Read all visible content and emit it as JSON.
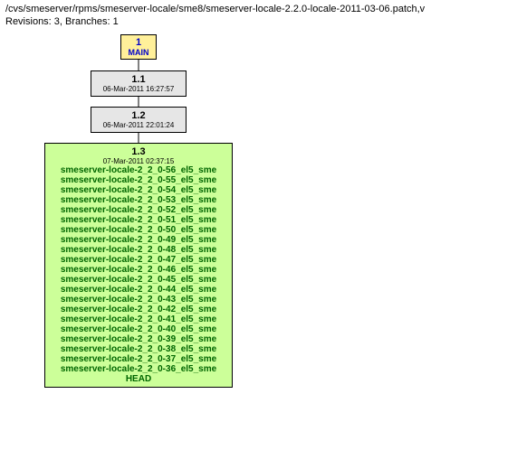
{
  "header": {
    "path": "/cvs/smeserver/rpms/smeserver-locale/sme8/smeserver-locale-2.2.0-locale-2011-03-06.patch,v",
    "meta": "Revisions: 3, Branches: 1"
  },
  "main": {
    "num": "1",
    "label": "MAIN"
  },
  "rev11": {
    "title": "1.1",
    "date": "06-Mar-2011 16:27:57"
  },
  "rev12": {
    "title": "1.2",
    "date": "06-Mar-2011 22:01:24"
  },
  "rev13": {
    "title": "1.3",
    "date": "07-Mar-2011 02:37:15",
    "tags": [
      "smeserver-locale-2_2_0-56_el5_sme",
      "smeserver-locale-2_2_0-55_el5_sme",
      "smeserver-locale-2_2_0-54_el5_sme",
      "smeserver-locale-2_2_0-53_el5_sme",
      "smeserver-locale-2_2_0-52_el5_sme",
      "smeserver-locale-2_2_0-51_el5_sme",
      "smeserver-locale-2_2_0-50_el5_sme",
      "smeserver-locale-2_2_0-49_el5_sme",
      "smeserver-locale-2_2_0-48_el5_sme",
      "smeserver-locale-2_2_0-47_el5_sme",
      "smeserver-locale-2_2_0-46_el5_sme",
      "smeserver-locale-2_2_0-45_el5_sme",
      "smeserver-locale-2_2_0-44_el5_sme",
      "smeserver-locale-2_2_0-43_el5_sme",
      "smeserver-locale-2_2_0-42_el5_sme",
      "smeserver-locale-2_2_0-41_el5_sme",
      "smeserver-locale-2_2_0-40_el5_sme",
      "smeserver-locale-2_2_0-39_el5_sme",
      "smeserver-locale-2_2_0-38_el5_sme",
      "smeserver-locale-2_2_0-37_el5_sme",
      "smeserver-locale-2_2_0-36_el5_sme",
      "HEAD"
    ]
  }
}
